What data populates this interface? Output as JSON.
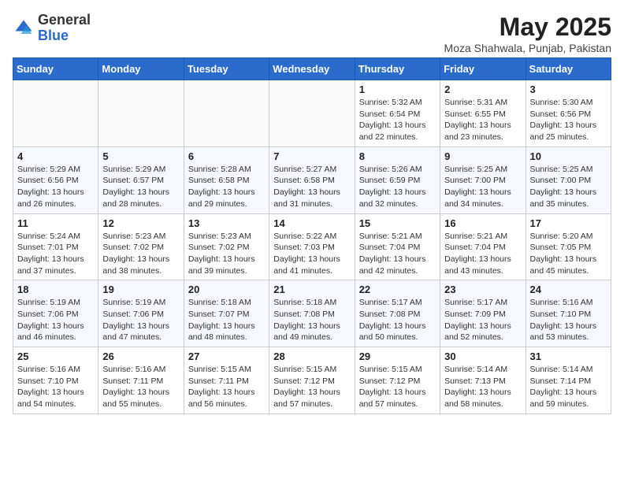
{
  "header": {
    "logo_general": "General",
    "logo_blue": "Blue",
    "month_title": "May 2025",
    "location": "Moza Shahwala, Punjab, Pakistan"
  },
  "days_of_week": [
    "Sunday",
    "Monday",
    "Tuesday",
    "Wednesday",
    "Thursday",
    "Friday",
    "Saturday"
  ],
  "weeks": [
    [
      {
        "num": "",
        "info": ""
      },
      {
        "num": "",
        "info": ""
      },
      {
        "num": "",
        "info": ""
      },
      {
        "num": "",
        "info": ""
      },
      {
        "num": "1",
        "info": "Sunrise: 5:32 AM\nSunset: 6:54 PM\nDaylight: 13 hours\nand 22 minutes."
      },
      {
        "num": "2",
        "info": "Sunrise: 5:31 AM\nSunset: 6:55 PM\nDaylight: 13 hours\nand 23 minutes."
      },
      {
        "num": "3",
        "info": "Sunrise: 5:30 AM\nSunset: 6:56 PM\nDaylight: 13 hours\nand 25 minutes."
      }
    ],
    [
      {
        "num": "4",
        "info": "Sunrise: 5:29 AM\nSunset: 6:56 PM\nDaylight: 13 hours\nand 26 minutes."
      },
      {
        "num": "5",
        "info": "Sunrise: 5:29 AM\nSunset: 6:57 PM\nDaylight: 13 hours\nand 28 minutes."
      },
      {
        "num": "6",
        "info": "Sunrise: 5:28 AM\nSunset: 6:58 PM\nDaylight: 13 hours\nand 29 minutes."
      },
      {
        "num": "7",
        "info": "Sunrise: 5:27 AM\nSunset: 6:58 PM\nDaylight: 13 hours\nand 31 minutes."
      },
      {
        "num": "8",
        "info": "Sunrise: 5:26 AM\nSunset: 6:59 PM\nDaylight: 13 hours\nand 32 minutes."
      },
      {
        "num": "9",
        "info": "Sunrise: 5:25 AM\nSunset: 7:00 PM\nDaylight: 13 hours\nand 34 minutes."
      },
      {
        "num": "10",
        "info": "Sunrise: 5:25 AM\nSunset: 7:00 PM\nDaylight: 13 hours\nand 35 minutes."
      }
    ],
    [
      {
        "num": "11",
        "info": "Sunrise: 5:24 AM\nSunset: 7:01 PM\nDaylight: 13 hours\nand 37 minutes."
      },
      {
        "num": "12",
        "info": "Sunrise: 5:23 AM\nSunset: 7:02 PM\nDaylight: 13 hours\nand 38 minutes."
      },
      {
        "num": "13",
        "info": "Sunrise: 5:23 AM\nSunset: 7:02 PM\nDaylight: 13 hours\nand 39 minutes."
      },
      {
        "num": "14",
        "info": "Sunrise: 5:22 AM\nSunset: 7:03 PM\nDaylight: 13 hours\nand 41 minutes."
      },
      {
        "num": "15",
        "info": "Sunrise: 5:21 AM\nSunset: 7:04 PM\nDaylight: 13 hours\nand 42 minutes."
      },
      {
        "num": "16",
        "info": "Sunrise: 5:21 AM\nSunset: 7:04 PM\nDaylight: 13 hours\nand 43 minutes."
      },
      {
        "num": "17",
        "info": "Sunrise: 5:20 AM\nSunset: 7:05 PM\nDaylight: 13 hours\nand 45 minutes."
      }
    ],
    [
      {
        "num": "18",
        "info": "Sunrise: 5:19 AM\nSunset: 7:06 PM\nDaylight: 13 hours\nand 46 minutes."
      },
      {
        "num": "19",
        "info": "Sunrise: 5:19 AM\nSunset: 7:06 PM\nDaylight: 13 hours\nand 47 minutes."
      },
      {
        "num": "20",
        "info": "Sunrise: 5:18 AM\nSunset: 7:07 PM\nDaylight: 13 hours\nand 48 minutes."
      },
      {
        "num": "21",
        "info": "Sunrise: 5:18 AM\nSunset: 7:08 PM\nDaylight: 13 hours\nand 49 minutes."
      },
      {
        "num": "22",
        "info": "Sunrise: 5:17 AM\nSunset: 7:08 PM\nDaylight: 13 hours\nand 50 minutes."
      },
      {
        "num": "23",
        "info": "Sunrise: 5:17 AM\nSunset: 7:09 PM\nDaylight: 13 hours\nand 52 minutes."
      },
      {
        "num": "24",
        "info": "Sunrise: 5:16 AM\nSunset: 7:10 PM\nDaylight: 13 hours\nand 53 minutes."
      }
    ],
    [
      {
        "num": "25",
        "info": "Sunrise: 5:16 AM\nSunset: 7:10 PM\nDaylight: 13 hours\nand 54 minutes."
      },
      {
        "num": "26",
        "info": "Sunrise: 5:16 AM\nSunset: 7:11 PM\nDaylight: 13 hours\nand 55 minutes."
      },
      {
        "num": "27",
        "info": "Sunrise: 5:15 AM\nSunset: 7:11 PM\nDaylight: 13 hours\nand 56 minutes."
      },
      {
        "num": "28",
        "info": "Sunrise: 5:15 AM\nSunset: 7:12 PM\nDaylight: 13 hours\nand 57 minutes."
      },
      {
        "num": "29",
        "info": "Sunrise: 5:15 AM\nSunset: 7:12 PM\nDaylight: 13 hours\nand 57 minutes."
      },
      {
        "num": "30",
        "info": "Sunrise: 5:14 AM\nSunset: 7:13 PM\nDaylight: 13 hours\nand 58 minutes."
      },
      {
        "num": "31",
        "info": "Sunrise: 5:14 AM\nSunset: 7:14 PM\nDaylight: 13 hours\nand 59 minutes."
      }
    ]
  ]
}
